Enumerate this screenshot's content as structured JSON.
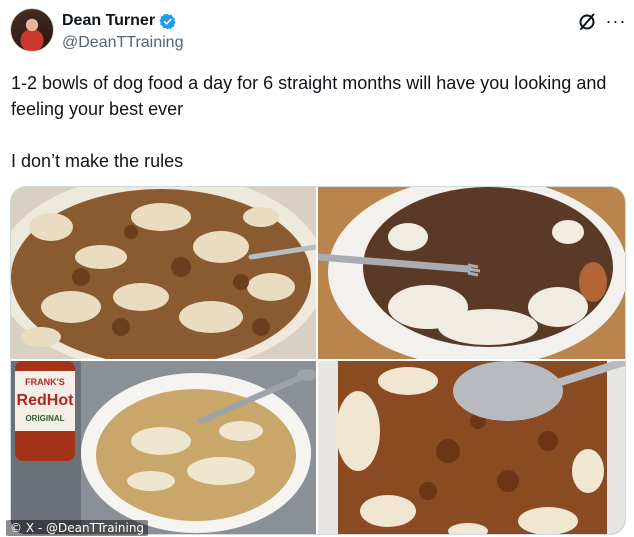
{
  "author": {
    "display_name": "Dean Turner",
    "handle": "@DeanTTraining",
    "verified": true,
    "avatar_icon": "profile-photo"
  },
  "header_icons": {
    "grok": "grok-icon",
    "more": "more-icon",
    "more_glyph": "···"
  },
  "tweet": {
    "line1": "1-2 bowls of dog food a day for 6 straight months will have you looking and feeling your best ever",
    "line2": "I don’t make the rules"
  },
  "media": {
    "count": 4,
    "photos": [
      "rice-and-mince-bowl",
      "rice-and-mince-plate-with-fork",
      "rice-bowl-with-hot-sauce-bottle",
      "rice-and-mince-closeup-with-spoon"
    ],
    "bottle_label_top": "FRANK'S",
    "bottle_label_main": "RedHot",
    "bottle_label_sub": "ORIGINAL"
  },
  "watermark": "© X - @DeanTTraining",
  "colors": {
    "verified_blue": "#1d9bf0",
    "text_primary": "#0f1419",
    "text_secondary": "#536471"
  }
}
